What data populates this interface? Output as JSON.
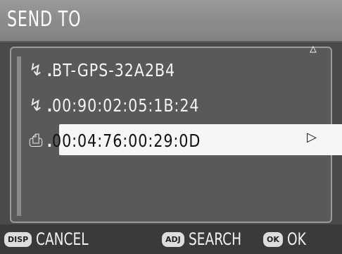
{
  "title": "SEND TO",
  "devices": [
    {
      "icon": "bluetooth-icon",
      "symbol": "ϟ",
      "prefix": ".",
      "address": "BT-GPS-32A2B4",
      "selected": false
    },
    {
      "icon": "bluetooth-icon",
      "symbol": "ϟ",
      "prefix": ".",
      "address": "00:90:02:05:1B:24",
      "selected": false
    },
    {
      "icon": "printer-icon",
      "symbol": "⎓",
      "prefix": ".",
      "address": "00:04:76:00:29:0D",
      "selected": true
    }
  ],
  "bottom": {
    "cancel_key": "DISP",
    "cancel_label": "CANCEL",
    "search_key": "ADJ",
    "search_label": "SEARCH",
    "ok_key": "OK",
    "ok_label": "OK"
  },
  "colors": {
    "title_bar": "#8c8c8c",
    "list_background": "#595959",
    "selected_row": "#f6f6f6",
    "bottom_bar": "#3a3a3a"
  }
}
